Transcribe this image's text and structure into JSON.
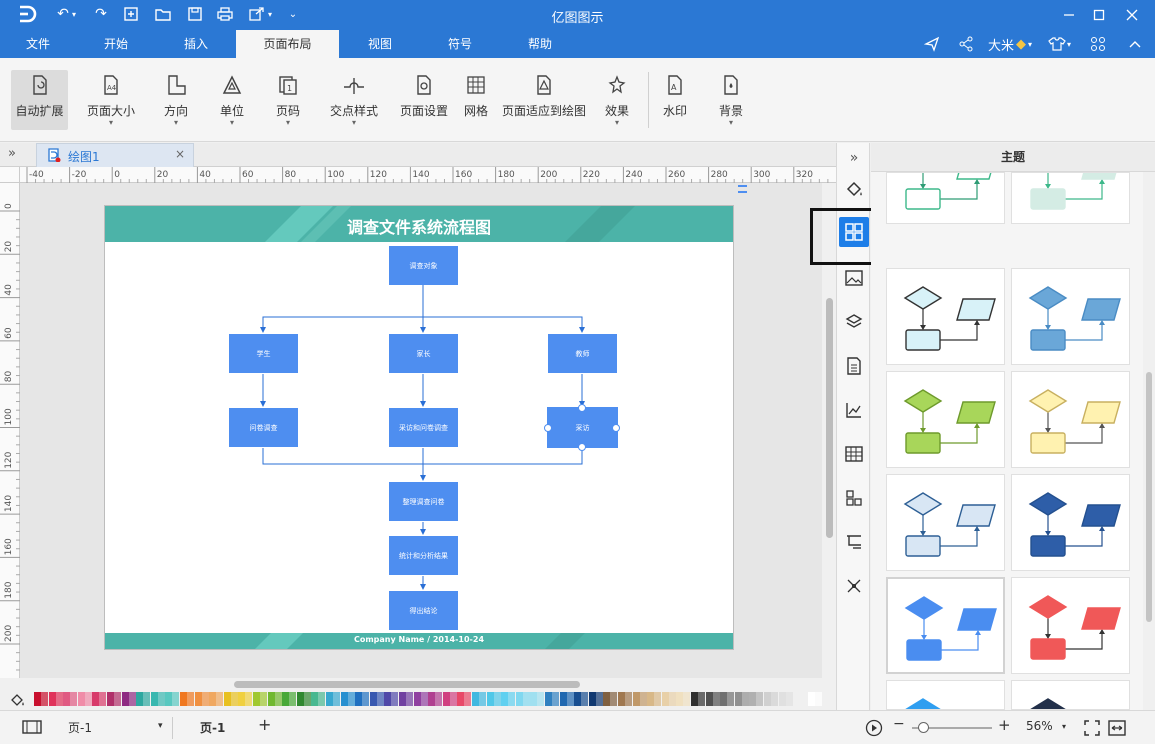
{
  "app": {
    "title": "亿图图示"
  },
  "menu": {
    "items": [
      "文件",
      "开始",
      "插入",
      "页面布局",
      "视图",
      "符号",
      "帮助"
    ],
    "active": "页面布局",
    "user": "大米"
  },
  "ribbon": {
    "buttons": [
      {
        "label": "自动扩展",
        "icon": "auto-expand-icon",
        "dropdown": false
      },
      {
        "label": "页面大小",
        "icon": "page-size-icon",
        "dropdown": true
      },
      {
        "label": "方向",
        "icon": "orientation-icon",
        "dropdown": true
      },
      {
        "label": "单位",
        "icon": "unit-icon",
        "dropdown": true
      },
      {
        "label": "页码",
        "icon": "page-number-icon",
        "dropdown": true
      },
      {
        "label": "交点样式",
        "icon": "jump-style-icon",
        "dropdown": true
      },
      {
        "label": "页面设置",
        "icon": "page-setup-icon",
        "dropdown": false
      },
      {
        "label": "网格",
        "icon": "grid-icon",
        "dropdown": false
      },
      {
        "label": "页面适应到绘图",
        "icon": "fit-to-drawing-icon",
        "dropdown": false
      },
      {
        "label": "效果",
        "icon": "effects-icon",
        "dropdown": true
      },
      {
        "label": "水印",
        "icon": "watermark-icon",
        "dropdown": false
      },
      {
        "label": "背景",
        "icon": "background-icon",
        "dropdown": true
      }
    ]
  },
  "document": {
    "tab_label": "绘图1"
  },
  "rulers": {
    "h_ticks": [
      "-40",
      "-20",
      "0",
      "20",
      "40",
      "60",
      "80",
      "100",
      "120",
      "140",
      "160",
      "180",
      "200",
      "220",
      "240",
      "260",
      "280",
      "300",
      "320"
    ],
    "v_ticks": [
      "0",
      "20",
      "40",
      "60",
      "80",
      "100",
      "120",
      "140",
      "160",
      "180",
      "200"
    ]
  },
  "diagram": {
    "title": "调查文件系统流程图",
    "footer": "Company Name / 2014-10-24",
    "nodes": [
      "调查对象",
      "学生",
      "家长",
      "教师",
      "问卷调查",
      "采访和问卷调查",
      "采访",
      "整理调查问卷",
      "统计和分析结果",
      "得出结论"
    ]
  },
  "panel": {
    "title": "主题",
    "themes": [
      {
        "shape": "#ffffff",
        "stroke": "#3db88a",
        "line": "#2f9c75",
        "arrow": "#2f9c75"
      },
      {
        "shape": "#d4ece4",
        "stroke": "#d4ece4",
        "line": "#3db88a",
        "arrow": "#3db88a"
      },
      {
        "shape": "#d8f2f8",
        "stroke": "#333333",
        "line": "#333333",
        "arrow": "#333333"
      },
      {
        "shape": "#6aa7d8",
        "stroke": "#4a8cc4",
        "line": "#4a8cc4",
        "arrow": "#4a8cc4"
      },
      {
        "shape": "#a8d65a",
        "stroke": "#6e9a2c",
        "line": "#6e9a2c",
        "arrow": "#6e9a2c"
      },
      {
        "shape": "#fff2b0",
        "stroke": "#c8b060",
        "line": "#555555",
        "arrow": "#555555"
      },
      {
        "shape": "#d8e6f4",
        "stroke": "#2d5f95",
        "line": "#2d5f95",
        "arrow": "#2d5f95"
      },
      {
        "shape": "#2e5ea8",
        "stroke": "#24508f",
        "line": "#24508f",
        "arrow": "#24508f"
      },
      {
        "shape": "#4a8df0",
        "stroke": "#4a8df0",
        "line": "#4a8df0",
        "arrow": "#4a8df0"
      },
      {
        "shape": "#f05858",
        "stroke": "#f05858",
        "line": "#333333",
        "arrow": "#333333"
      },
      {
        "shape": "#2f9ef0",
        "stroke": "#2f9ef0",
        "line": "#2f9ef0",
        "arrow": "#2f9ef0"
      },
      {
        "shape": "#22304a",
        "stroke": "#22304a",
        "line": "#22304a",
        "arrow": "#22304a"
      }
    ]
  },
  "palette": {
    "colors": [
      "#c8102e",
      "#e0325a",
      "#e05a82",
      "#f08ca8",
      "#d83a6a",
      "#b0306a",
      "#8e2a82",
      "#2ea8a0",
      "#38b8b0",
      "#58c8c0",
      "#f07820",
      "#f09040",
      "#f0a860",
      "#e8c020",
      "#f0d040",
      "#a0c830",
      "#70b830",
      "#48a838",
      "#308830",
      "#48b890",
      "#38a8d0",
      "#2890d0",
      "#2070c0",
      "#3858b0",
      "#5048a8",
      "#7040a0",
      "#9040a0",
      "#b04090",
      "#d04080",
      "#e84868",
      "#40b8e0",
      "#50c8e8",
      "#60d0f0",
      "#80d8f0",
      "#a0e0f0",
      "#3080c0",
      "#2068b0",
      "#184e90",
      "#103870",
      "#806040",
      "#a07850",
      "#c09868",
      "#d8b888",
      "#e8d0a8",
      "#f0e0c0",
      "#303030",
      "#505050",
      "#707070",
      "#909090",
      "#b0b0b0",
      "#d0d0d0",
      "#e0e0e0",
      "#f0f0f0",
      "#ffffff"
    ]
  },
  "status": {
    "page_dropdown": "页-1",
    "page_tab": "页-1",
    "zoom": "56%"
  }
}
